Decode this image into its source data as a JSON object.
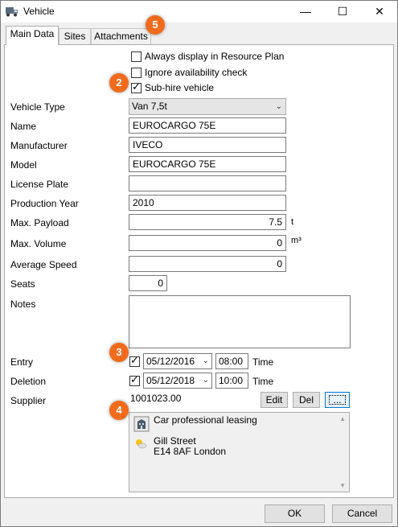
{
  "window": {
    "title": "Vehicle",
    "icon": "truck-icon",
    "controls": {
      "minimize": "—",
      "maximize": "☐",
      "close": "✕"
    }
  },
  "tabs": [
    {
      "label": "Main Data",
      "active": true
    },
    {
      "label": "Sites",
      "active": false
    },
    {
      "label": "Attachments",
      "active": false
    }
  ],
  "options": {
    "always_display": {
      "label": "Always display in Resource Plan",
      "checked": false
    },
    "ignore_availability": {
      "label": "Ignore availability check",
      "checked": false
    },
    "sub_hire": {
      "label": "Sub-hire vehicle",
      "checked": true
    }
  },
  "form": {
    "vehicle_type": {
      "label": "Vehicle Type",
      "value": "Van 7,5t"
    },
    "name": {
      "label": "Name",
      "value": "EUROCARGO 75E"
    },
    "manufacturer": {
      "label": "Manufacturer",
      "value": "IVECO"
    },
    "model": {
      "label": "Model",
      "value": "EUROCARGO 75E"
    },
    "license_plate": {
      "label": "License Plate",
      "value": ""
    },
    "production_year": {
      "label": "Production Year",
      "value": "2010"
    },
    "max_payload": {
      "label": "Max. Payload",
      "value": "7.5",
      "unit": "t"
    },
    "max_volume": {
      "label": "Max. Volume",
      "value": "0",
      "unit": "m³"
    },
    "average_speed": {
      "label": "Average Speed",
      "value": "0"
    },
    "seats": {
      "label": "Seats",
      "value": "0"
    },
    "notes": {
      "label": "Notes",
      "value": ""
    },
    "entry": {
      "label": "Entry",
      "checked": true,
      "date": "05/12/2016",
      "time": "08:00",
      "time_label": "Time"
    },
    "deletion": {
      "label": "Deletion",
      "checked": true,
      "date": "05/12/2018",
      "time": "10:00",
      "time_label": "Time"
    },
    "supplier": {
      "label": "Supplier",
      "number": "1001023.00",
      "edit_label": "Edit",
      "del_label": "Del",
      "browse_label": "...",
      "company": "Car professional leasing",
      "street": "Gill Street",
      "city": "E14 8AF London"
    }
  },
  "markers": [
    "2",
    "3",
    "4",
    "5"
  ],
  "footer": {
    "ok_label": "OK",
    "cancel_label": "Cancel"
  },
  "colors": {
    "marker": "#f26b1d",
    "focus": "#0078d7"
  }
}
